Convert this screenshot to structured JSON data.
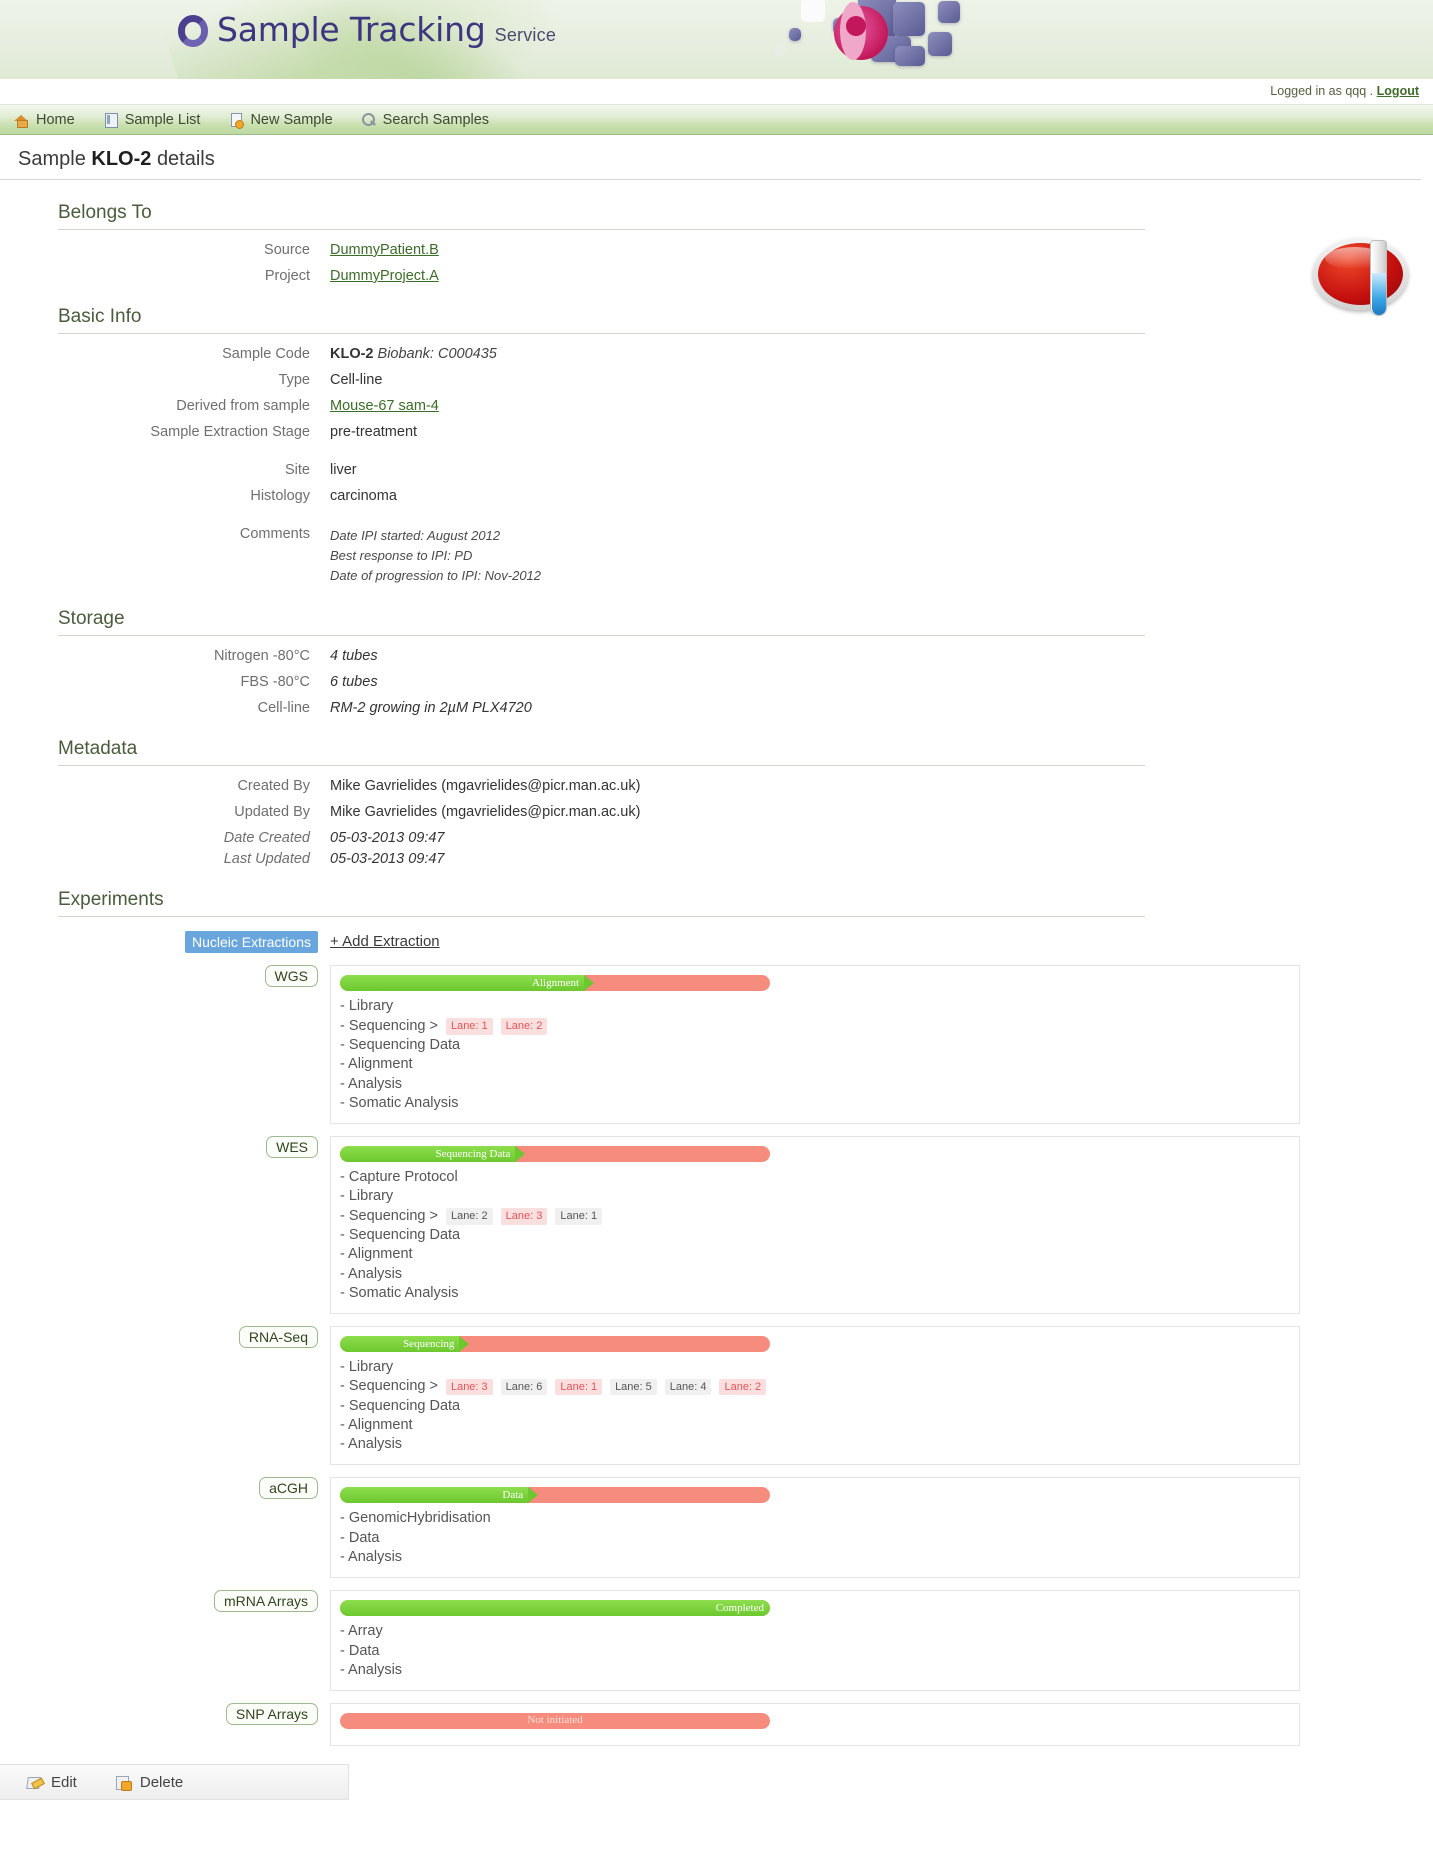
{
  "brand": {
    "title": "Sample Tracking",
    "subtitle": "Service",
    "logo_icon": "ring-logo-icon"
  },
  "login": {
    "text": "Logged in as qqq .",
    "logout_label": "Logout"
  },
  "nav": {
    "items": [
      {
        "label": "Home",
        "icon": "home-icon"
      },
      {
        "label": "Sample List",
        "icon": "list-icon"
      },
      {
        "label": "New Sample",
        "icon": "new-sample-icon"
      },
      {
        "label": "Search Samples",
        "icon": "search-icon"
      }
    ]
  },
  "page": {
    "title_prefix": "Sample",
    "title_code": "KLO-2",
    "title_suffix": "details"
  },
  "belongs_to": {
    "heading": "Belongs To",
    "rows": [
      {
        "label": "Source",
        "value": "DummyPatient.B",
        "link": true
      },
      {
        "label": "Project",
        "value": "DummyProject.A",
        "link": true
      }
    ]
  },
  "basic_info": {
    "heading": "Basic Info",
    "sample_code_label": "Sample Code",
    "sample_code_value": "KLO-2",
    "sample_code_biobank": "Biobank: C000435",
    "rows": [
      {
        "label": "Type",
        "value": "Cell-line",
        "link": false
      },
      {
        "label": "Derived from sample",
        "value": "Mouse-67 sam-4",
        "link": true
      },
      {
        "label": "Sample Extraction Stage",
        "value": "pre-treatment",
        "link": false
      }
    ],
    "rows2": [
      {
        "label": "Site",
        "value": "liver"
      },
      {
        "label": "Histology",
        "value": "carcinoma"
      }
    ],
    "comments_label": "Comments",
    "comments": [
      "Date IPI started: August 2012",
      "Best response to IPI: PD",
      "Date of progression to IPI: Nov-2012"
    ]
  },
  "storage": {
    "heading": "Storage",
    "rows": [
      {
        "label": "Nitrogen -80°C",
        "value": "4 tubes"
      },
      {
        "label": "FBS -80°C",
        "value": "6 tubes"
      },
      {
        "label": "Cell-line",
        "value": "RM-2 growing in 2µM PLX4720"
      }
    ]
  },
  "metadata": {
    "heading": "Metadata",
    "rows": [
      {
        "label": "Created By",
        "value": "Mike Gavrielides (mgavrielides@picr.man.ac.uk)",
        "small": false
      },
      {
        "label": "Updated By",
        "value": "Mike Gavrielides (mgavrielides@picr.man.ac.uk)",
        "small": false
      },
      {
        "label": "Date Created",
        "value": "05-03-2013 09:47",
        "small": true
      },
      {
        "label": "Last Updated",
        "value": "05-03-2013 09:47",
        "small": true
      }
    ]
  },
  "experiments": {
    "heading": "Experiments",
    "extraction_tag": "Nucleic Extractions",
    "add_extraction_label": "+ Add Extraction",
    "items": [
      {
        "tag": "WGS",
        "progress_label": "Alignment",
        "progress_percent": 57,
        "state": "partial",
        "steps": [
          {
            "text": "- Library",
            "lanes": []
          },
          {
            "text": "- Sequencing >",
            "lanes": [
              {
                "label": "Lane: 1",
                "status": "red"
              },
              {
                "label": "Lane: 2",
                "status": "red"
              }
            ]
          },
          {
            "text": "- Sequencing Data",
            "lanes": []
          },
          {
            "text": "- Alignment",
            "lanes": []
          },
          {
            "text": "- Analysis",
            "lanes": []
          },
          {
            "text": "- Somatic Analysis",
            "lanes": []
          }
        ]
      },
      {
        "tag": "WES",
        "progress_label": "Sequencing Data",
        "progress_percent": 41,
        "state": "partial",
        "steps": [
          {
            "text": "- Capture Protocol",
            "lanes": []
          },
          {
            "text": "- Library",
            "lanes": []
          },
          {
            "text": "- Sequencing >",
            "lanes": [
              {
                "label": "Lane: 2",
                "status": "grey"
              },
              {
                "label": "Lane: 3",
                "status": "red"
              },
              {
                "label": "Lane: 1",
                "status": "grey"
              }
            ]
          },
          {
            "text": "- Sequencing Data",
            "lanes": []
          },
          {
            "text": "- Alignment",
            "lanes": []
          },
          {
            "text": "- Analysis",
            "lanes": []
          },
          {
            "text": "- Somatic Analysis",
            "lanes": []
          }
        ]
      },
      {
        "tag": "RNA-Seq",
        "progress_label": "Sequencing",
        "progress_percent": 28,
        "state": "partial",
        "steps": [
          {
            "text": "- Library",
            "lanes": []
          },
          {
            "text": "- Sequencing >",
            "lanes": [
              {
                "label": "Lane: 3",
                "status": "red"
              },
              {
                "label": "Lane: 6",
                "status": "grey"
              },
              {
                "label": "Lane: 1",
                "status": "red"
              },
              {
                "label": "Lane: 5",
                "status": "grey"
              },
              {
                "label": "Lane: 4",
                "status": "grey"
              },
              {
                "label": "Lane: 2",
                "status": "red"
              }
            ]
          },
          {
            "text": "- Sequencing Data",
            "lanes": []
          },
          {
            "text": "- Alignment",
            "lanes": []
          },
          {
            "text": "- Analysis",
            "lanes": []
          }
        ]
      },
      {
        "tag": "aCGH",
        "progress_label": "Data",
        "progress_percent": 44,
        "state": "partial",
        "steps": [
          {
            "text": "- GenomicHybridisation",
            "lanes": []
          },
          {
            "text": "- Data",
            "lanes": []
          },
          {
            "text": "- Analysis",
            "lanes": []
          }
        ]
      },
      {
        "tag": "mRNA Arrays",
        "progress_label": "Completed",
        "progress_percent": 100,
        "state": "complete",
        "steps": [
          {
            "text": "- Array",
            "lanes": []
          },
          {
            "text": "- Data",
            "lanes": []
          },
          {
            "text": "- Analysis",
            "lanes": []
          }
        ]
      },
      {
        "tag": "SNP Arrays",
        "progress_label": "Not initiated",
        "progress_percent": 0,
        "state": "none",
        "steps": []
      }
    ]
  },
  "footer": {
    "edit_label": "Edit",
    "delete_label": "Delete"
  },
  "colors": {
    "accent_green": "#6cc82e",
    "bar_red": "#f58c7d",
    "heading_green": "#4a5c3c",
    "link_green": "#3d6b29",
    "selected_blue": "#6aa6de"
  },
  "sample_image": {
    "icon": "petri-dish-test-tube-icon"
  }
}
